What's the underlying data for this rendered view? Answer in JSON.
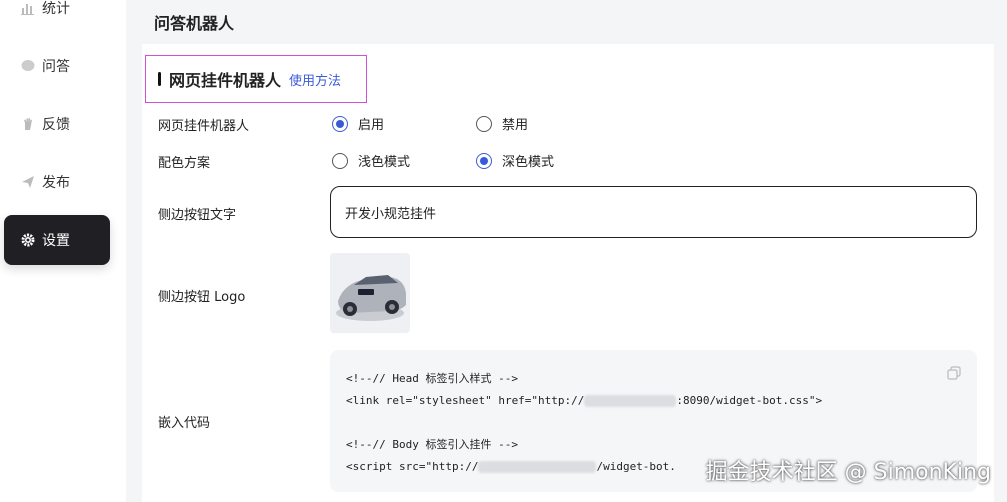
{
  "sidebar": {
    "items": [
      {
        "label": "统计",
        "icon": "bar-chart-icon"
      },
      {
        "label": "问答",
        "icon": "chat-bubble-icon"
      },
      {
        "label": "反馈",
        "icon": "hand-icon"
      },
      {
        "label": "发布",
        "icon": "paper-plane-icon"
      },
      {
        "label": "设置",
        "icon": "gear-icon",
        "active": true
      }
    ]
  },
  "header": {
    "title": "问答机器人"
  },
  "section": {
    "title": "网页挂件机器人",
    "link": "使用方法"
  },
  "form": {
    "widget_label": "网页挂件机器人",
    "widget_options": [
      "启用",
      "禁用"
    ],
    "widget_selected": "启用",
    "color_label": "配色方案",
    "color_options": [
      "浅色模式",
      "深色模式"
    ],
    "color_selected": "深色模式",
    "side_text_label": "侧边按钮文字",
    "side_text_value": "开发小规范挂件",
    "side_logo_label": "侧边按钮 Logo",
    "embed_label": "嵌入代码"
  },
  "code": {
    "line1": "<!--// Head 标签引入样式 -->",
    "line2_prefix": "<link rel=\"stylesheet\" href=\"http://",
    "line2_suffix": ":8090/widget-bot.css\">",
    "line3": "<!--// Body 标签引入挂件 -->",
    "line4_prefix": "<script src=\"http://",
    "line4_suffix": "/widget-bot."
  },
  "watermark": "掘金技术社区 @ SimonKing",
  "colors": {
    "accent": "#3a5bd9",
    "active_nav": "#1f1f24",
    "highlight_border": "#d14fd1"
  }
}
